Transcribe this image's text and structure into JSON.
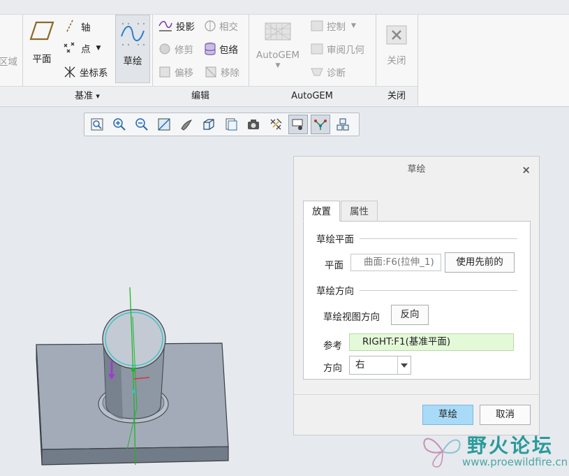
{
  "ribbon": {
    "partial_left_label": "区域",
    "datum": {
      "plane_label": "平面",
      "axis_label": "轴",
      "point_label": "点",
      "csys_label": "坐标系",
      "group_label": "基准",
      "group_dropdown": "▾"
    },
    "sketch": {
      "label": "草绘"
    },
    "edit": {
      "project_label": "投影",
      "intersect_label": "相交",
      "trim_label": "修剪",
      "wrap_label": "包络",
      "offset_label": "偏移",
      "move_label": "移除",
      "group_label": "编辑"
    },
    "autogem": {
      "main_label": "AutoGEM",
      "control_label": "控制",
      "review_label": "审阅几何",
      "diagnose_label": "诊断",
      "group_label": "AutoGEM"
    },
    "close": {
      "button_label": "关闭",
      "group_label": "关闭"
    }
  },
  "view_toolbar": {
    "icons": [
      "refit-icon",
      "zoom-in-icon",
      "zoom-out-icon",
      "repaint-icon",
      "display-style-icon",
      "saved-orientations-icon",
      "named-views-icon",
      "view-manager-icon",
      "datum-display-icon",
      "spin-center-icon",
      "annotation-display-icon",
      "plane-display-icon",
      "axis-display-icon"
    ]
  },
  "dialog": {
    "title": "草绘",
    "close_glyph": "×",
    "tabs": [
      {
        "label": "放置"
      },
      {
        "label": "属性"
      }
    ],
    "sketch_plane_section": "草绘平面",
    "plane_label": "平面",
    "plane_value": "曲面:F6(拉伸_1)",
    "use_previous_button": "使用先前的",
    "orientation_section": "草绘方向",
    "view_direction_label": "草绘视图方向",
    "flip_button": "反向",
    "reference_label": "参考",
    "reference_value": "RIGHT:F1(基准平面)",
    "direction_label": "方向",
    "direction_value": "右",
    "sketch_button": "草绘",
    "cancel_button": "取消"
  },
  "watermark": {
    "title": "野火论坛",
    "url": "www.proewildfire.cn"
  },
  "colors": {
    "accent_button": "#a9dbf9",
    "reference_field": "#e4f9d8",
    "model_body": "#9ba4b1"
  }
}
